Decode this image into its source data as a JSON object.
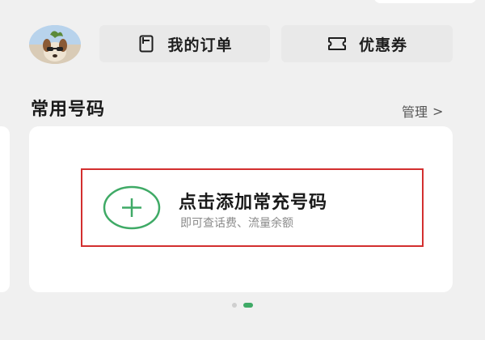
{
  "header": {
    "orders_label": "我的订单",
    "coupons_label": "优惠券",
    "orders_icon": "document-icon",
    "coupons_icon": "ticket-icon"
  },
  "section": {
    "title": "常用号码",
    "manage_label": "管理",
    "manage_chevron": ">"
  },
  "add_number": {
    "title": "点击添加常充号码",
    "subtitle": "即可查话费、流量余额",
    "icon": "plus-circle-icon",
    "accent_color": "#3faa66",
    "highlight_color": "#d32f2f"
  },
  "pagination": {
    "total": 2,
    "active_index": 2,
    "active_color": "#3faa66"
  }
}
